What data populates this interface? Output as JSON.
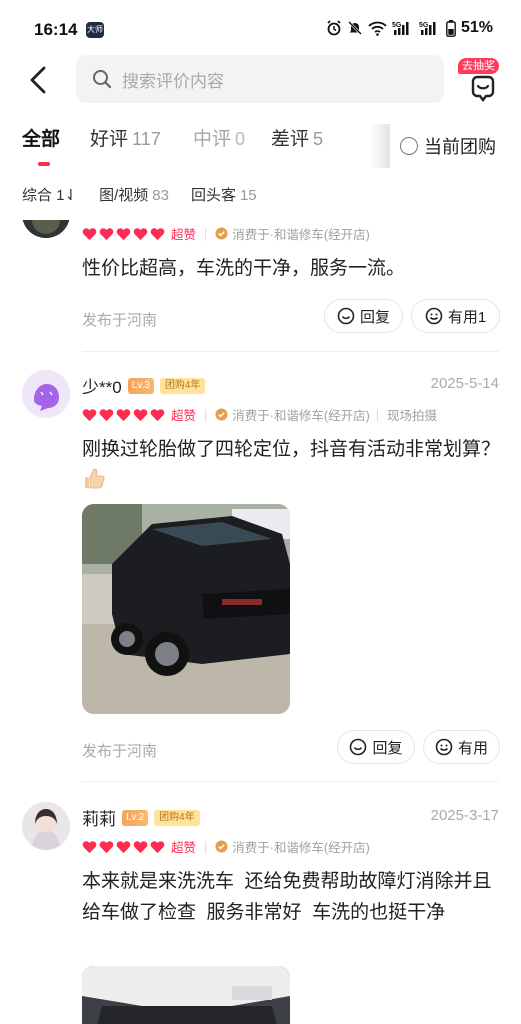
{
  "status": {
    "time": "16:14",
    "app_badge": "大师",
    "battery": "51%",
    "net1": "5G",
    "net2": "5G"
  },
  "search": {
    "placeholder": "搜索评价内容"
  },
  "lottery": {
    "label": "去抽奖"
  },
  "tabs": [
    {
      "label": "全部",
      "count": ""
    },
    {
      "label": "好评",
      "count": "117"
    },
    {
      "label": "中评",
      "count": "0"
    },
    {
      "label": "差评",
      "count": "5"
    }
  ],
  "current_group": {
    "label": "当前团购"
  },
  "filters": [
    {
      "label": "综合 1⇃",
      "count": ""
    },
    {
      "label": "图/视频",
      "count": "83"
    },
    {
      "label": "回头客",
      "count": "15"
    }
  ],
  "reviews": [
    {
      "super_label": "超赞",
      "consume": "消费于·和谐修车(经开店)",
      "text": "性价比超高，车洗的干净，服务一流。",
      "location": "发布于河南",
      "reply": "回复",
      "useful": "有用1"
    },
    {
      "name": "少**0",
      "level": "Lv.3",
      "group": "团购4年",
      "date": "2025-5-14",
      "super_label": "超赞",
      "consume": "消费于·和谐修车(经开店)",
      "photo_tag": "现场拍摄",
      "text": "刚换过轮胎做了四轮定位，抖音有活动非常划算？",
      "location": "发布于河南",
      "reply": "回复",
      "useful": "有用"
    },
    {
      "name": "莉莉",
      "level": "Lv.2",
      "group": "团购4年",
      "date": "2025-3-17",
      "super_label": "超赞",
      "consume": "消费于·和谐修车(经开店)",
      "text": "本来就是来洗洗车  还给免费帮助故障灯消除并且给车做了检查  服务非常好  车洗的也挺干净"
    }
  ],
  "colors": {
    "accent": "#fe2c55",
    "level_badge": "#f6a35b",
    "group_badge": "#ffe39a"
  }
}
